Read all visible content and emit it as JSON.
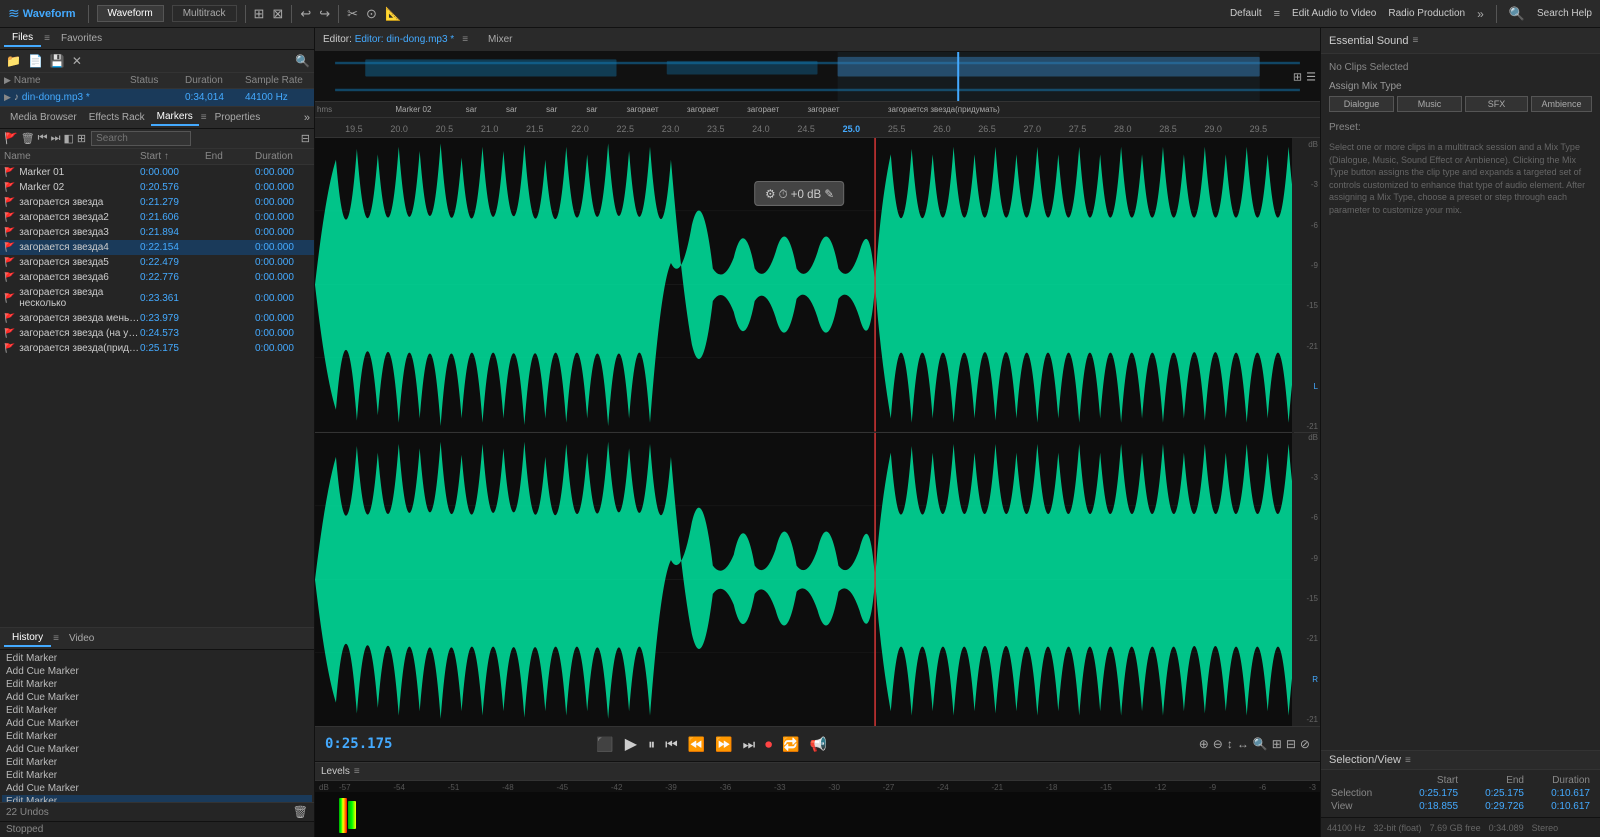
{
  "topBar": {
    "logo": "Waveform",
    "tabs": [
      {
        "label": "Waveform",
        "active": true
      },
      {
        "label": "Multitrack",
        "active": false
      }
    ],
    "workspace": "Default",
    "editMenu": "Edit Audio to Video",
    "radioProduction": "Radio Production",
    "searchHelp": "Search Help"
  },
  "leftPanel": {
    "fileTabs": [
      "Files",
      "Favorites"
    ],
    "activeFileTab": "Files",
    "filesToolbar": [
      "folder-icon",
      "open-icon",
      "save-icon",
      "close-icon",
      "search-icon"
    ],
    "filesHeader": [
      "Name",
      "Status",
      "Duration",
      "Sample Rate"
    ],
    "files": [
      {
        "name": "din-dong.mp3 *",
        "status": "",
        "duration": "0:34,014",
        "sampleRate": "44100 Hz"
      }
    ],
    "markerTabs": [
      "Media Browser",
      "Effects Rack",
      "Markers",
      "Properties"
    ],
    "activeMarkerTab": "Markers",
    "markersHeader": [
      "Name",
      "Start ↑",
      "End",
      "Duration"
    ],
    "markers": [
      {
        "name": "Marker 01",
        "start": "0:00.000",
        "end": "",
        "duration": "0:00.000",
        "selected": false
      },
      {
        "name": "Marker 02",
        "start": "0:20.576",
        "end": "",
        "duration": "0:00.000",
        "selected": false
      },
      {
        "name": "загорается звезда",
        "start": "0:21.279",
        "end": "",
        "duration": "0:00.000",
        "selected": false
      },
      {
        "name": "загорается звезда2",
        "start": "0:21.606",
        "end": "",
        "duration": "0:00.000",
        "selected": false
      },
      {
        "name": "загорается звезда3",
        "start": "0:21.894",
        "end": "",
        "duration": "0:00.000",
        "selected": false
      },
      {
        "name": "загорается звезда4",
        "start": "0:22.154",
        "end": "",
        "duration": "0:00.000",
        "selected": true
      },
      {
        "name": "загорается звезда5",
        "start": "0:22.479",
        "end": "",
        "duration": "0:00.000",
        "selected": false
      },
      {
        "name": "загорается звезда6",
        "start": "0:22.776",
        "end": "",
        "duration": "0:00.000",
        "selected": false
      },
      {
        "name": "загорается звезда несколько",
        "start": "0:23.361",
        "end": "",
        "duration": "0:00.000",
        "selected": false
      },
      {
        "name": "загорается звезда меньше не...",
        "start": "0:23.979",
        "end": "",
        "duration": "0:00.000",
        "selected": false
      },
      {
        "name": "загорается звезда (на убиваю...",
        "start": "0:24.573",
        "end": "",
        "duration": "0:00.000",
        "selected": false
      },
      {
        "name": "загорается звезда(придумать)",
        "start": "0:25.175",
        "end": "",
        "duration": "0:00.000",
        "selected": false
      }
    ],
    "historyTabs": [
      "History",
      "Video"
    ],
    "activeHistoryTab": "History",
    "historyItems": [
      {
        "label": "Edit Marker"
      },
      {
        "label": "Add Cue Marker"
      },
      {
        "label": "Edit Marker"
      },
      {
        "label": "Add Cue Marker"
      },
      {
        "label": "Edit Marker"
      },
      {
        "label": "Add Cue Marker"
      },
      {
        "label": "Edit Marker"
      },
      {
        "label": "Add Cue Marker"
      },
      {
        "label": "Edit Marker"
      },
      {
        "label": "Edit Marker"
      },
      {
        "label": "Add Cue Marker"
      },
      {
        "label": "Edit Marker",
        "selected": true
      }
    ],
    "undoCount": "22 Undos",
    "status": "Stopped"
  },
  "editorPanel": {
    "title": "Editor: din-dong.mp3 *",
    "mixerTab": "Mixer",
    "timePosition": "0:25.175",
    "rulerMarks": [
      "19.5",
      "20.0",
      "20.5",
      "21.0",
      "21.5",
      "22.0",
      "22.5",
      "23.0",
      "23.5",
      "24.0",
      "24.5",
      "25.0",
      "25.5",
      "26.0",
      "26.5",
      "27.0",
      "27.5",
      "28.0",
      "28.5",
      "29.0",
      "29.5"
    ],
    "markerLabels": [
      {
        "label": "Marker 02",
        "pos": 8
      },
      {
        "label": "sar",
        "pos": 13
      },
      {
        "label": "sar",
        "pos": 16
      },
      {
        "label": "sar",
        "pos": 19
      },
      {
        "label": "sar",
        "pos": 22
      },
      {
        "label": "загорает",
        "pos": 25
      },
      {
        "label": "загорает",
        "pos": 29
      },
      {
        "label": "загорает",
        "pos": 33
      },
      {
        "label": "загорает",
        "pos": 37
      },
      {
        "label": "загорается звезда(придумать)",
        "pos": 56
      }
    ],
    "volumePopup": "+0 dB",
    "dbScaleTop": [
      "-3",
      "-6",
      "-9",
      "-15",
      "-21",
      "-21"
    ],
    "dbScaleBottom": [
      "-3",
      "-6",
      "-9",
      "-15",
      "-21",
      "-21"
    ],
    "levelsLabel": "Levels",
    "levelsScale": [
      "dB",
      "-57",
      "-54",
      "-51",
      "-48",
      "-45",
      "-42",
      "-39",
      "-36",
      "-33",
      "-30",
      "-27",
      "-24",
      "-21",
      "-18",
      "-15",
      "-12",
      "-9",
      "-6",
      "-3"
    ]
  },
  "transport": {
    "time": "0:25.175",
    "buttons": [
      "stop",
      "play",
      "pause",
      "to-start",
      "rewind",
      "forward",
      "to-end",
      "record",
      "loop",
      "output"
    ]
  },
  "rightPanel": {
    "title": "Essential Sound",
    "noClipsMsg": "No Clips Selected",
    "assignMixTypeLabel": "Assign Mix Type",
    "mixTypeButtons": [
      "Dialogue",
      "Music",
      "SFX",
      "Ambience"
    ],
    "presetLabel": "Preset:",
    "description": "Select one or more clips in a multitrack session and a Mix Type (Dialogue, Music, Sound Effect or Ambience). Clicking the Mix Type button assigns the clip type and expands a targeted set of controls customized to enhance that type of audio element. After assigning a Mix Type, choose a preset or step through each parameter to customize your mix.",
    "selectionView": {
      "title": "Selection/View",
      "headers": [
        "",
        "Start",
        "End",
        "Duration"
      ],
      "selection": [
        "Selection",
        "0:25.175",
        "0:25.175",
        "0:10.617"
      ],
      "view": [
        "View",
        "0:18.855",
        "0:29.726",
        "0:10.617"
      ]
    },
    "statusBar": {
      "sampleRate": "44100 Hz",
      "bitDepth": "32-bit (float)",
      "fileSize": "7.69 GB free",
      "totalDuration": "0:34.089",
      "channels": "Stereo"
    }
  }
}
